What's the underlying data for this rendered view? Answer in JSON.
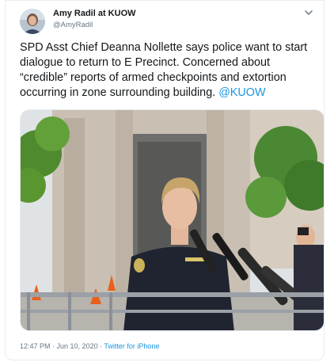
{
  "author": {
    "display_name": "Amy Radil at KUOW",
    "handle": "@AmyRadil"
  },
  "tweet": {
    "text": "SPD Asst Chief Deanna Nollette says police want to start dialogue to return to E Precinct. Concerned about “credible” reports of armed checkpoints and extortion occurring in zone surrounding building. ",
    "mention": "@KUOW"
  },
  "meta": {
    "time": "12:47 PM",
    "separator1": " · ",
    "date": "Jun 10, 2020",
    "separator2": " · ",
    "source": "Twitter for iPhone"
  },
  "icons": {
    "menu": "chevron-down-icon"
  },
  "colors": {
    "link": "#1b95e0",
    "secondary_text": "#657786",
    "border": "#e6ecf0"
  }
}
